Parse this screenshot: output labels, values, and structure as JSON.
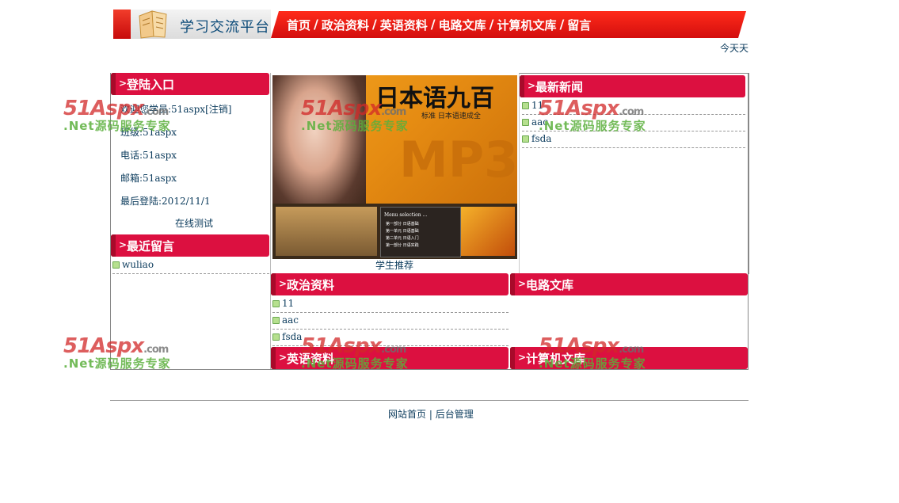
{
  "header": {
    "site_title": "学习交流平台",
    "nav": [
      "首页",
      "政治资料",
      "英语资料",
      "电路文库",
      "计算机文库",
      "留言"
    ],
    "nav_separator": "/",
    "date_text": "今天天"
  },
  "login": {
    "title": "登陆入口",
    "welcome": "欢迎您学员:51aspx[注销]",
    "class_label": "班级:51aspx",
    "phone": "电话:51aspx",
    "email": "邮箱:51aspx",
    "last_login": "最后登陆:2012/11/1",
    "online_test": "在线测试"
  },
  "recent_messages": {
    "title": "最近留言",
    "items": [
      "wuliao"
    ]
  },
  "banner": {
    "text_top": "日本语九百",
    "text_mid": "MP3",
    "caption": "学生推荐",
    "menu_title": "Menu selection ...",
    "menu_items": [
      "第一部分 日语基础",
      "第一单元 日语基础",
      "第二单元 日语入门",
      "第一部分 日语实践"
    ],
    "badge": "标准 日本语速成全"
  },
  "latest_news": {
    "title": "最新新闻",
    "items": [
      "11",
      "aac",
      "fsda"
    ]
  },
  "politics": {
    "title": "政治资料",
    "items": [
      "11",
      "aac",
      "fsda"
    ]
  },
  "circuits": {
    "title": "电路文库",
    "items": []
  },
  "english": {
    "title": "英语资料"
  },
  "computer": {
    "title": "计算机文库"
  },
  "footer": {
    "home": "网站首页",
    "separator": "|",
    "admin": "后台管理"
  },
  "watermark": {
    "brand": "51Aspx",
    "domain": ".com",
    "slogan": ".Net源码服务专家"
  },
  "colors": {
    "nav_red": "#e0150f",
    "bar_red": "#dc1040",
    "link_blue": "#0b3b5c",
    "bullet_green": "#b6e08f"
  }
}
